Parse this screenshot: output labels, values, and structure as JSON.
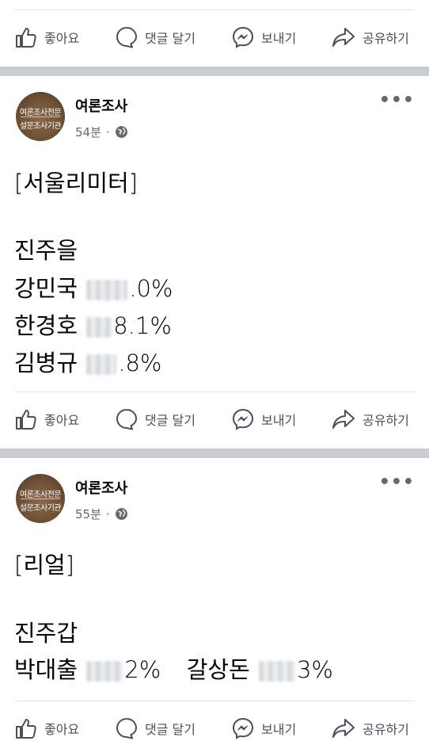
{
  "actions": {
    "like": "좋아요",
    "comment": "댓글 달기",
    "send": "보내기",
    "share": "공유하기"
  },
  "posts": [
    {
      "author": "여론조사",
      "avatar_top": "여론조사전문",
      "avatar_bottom": "설문조사기관",
      "time": "54분",
      "dot": "·",
      "more": "•••",
      "lines": {
        "source": "[서울리미터]",
        "district": "진주을",
        "c1_name": "강민국",
        "c1_tail": ".0%",
        "c2_name": "한경호",
        "c2_tail": "8.1%",
        "c3_name": "김병규",
        "c3_tail": ".8%"
      }
    },
    {
      "author": "여론조사",
      "avatar_top": "여론조사전문",
      "avatar_bottom": "설문조사기관",
      "time": "55분",
      "dot": "·",
      "more": "•••",
      "lines": {
        "source": "[리얼]",
        "district": "진주갑",
        "c1_name": "박대출",
        "c1_tail": "2%",
        "c2_name": "갈상돈",
        "c2_tail": "3%"
      }
    }
  ],
  "colors": {
    "separator": "#c9ccd1",
    "secondary_text": "#65676b",
    "primary_text": "#050505"
  }
}
